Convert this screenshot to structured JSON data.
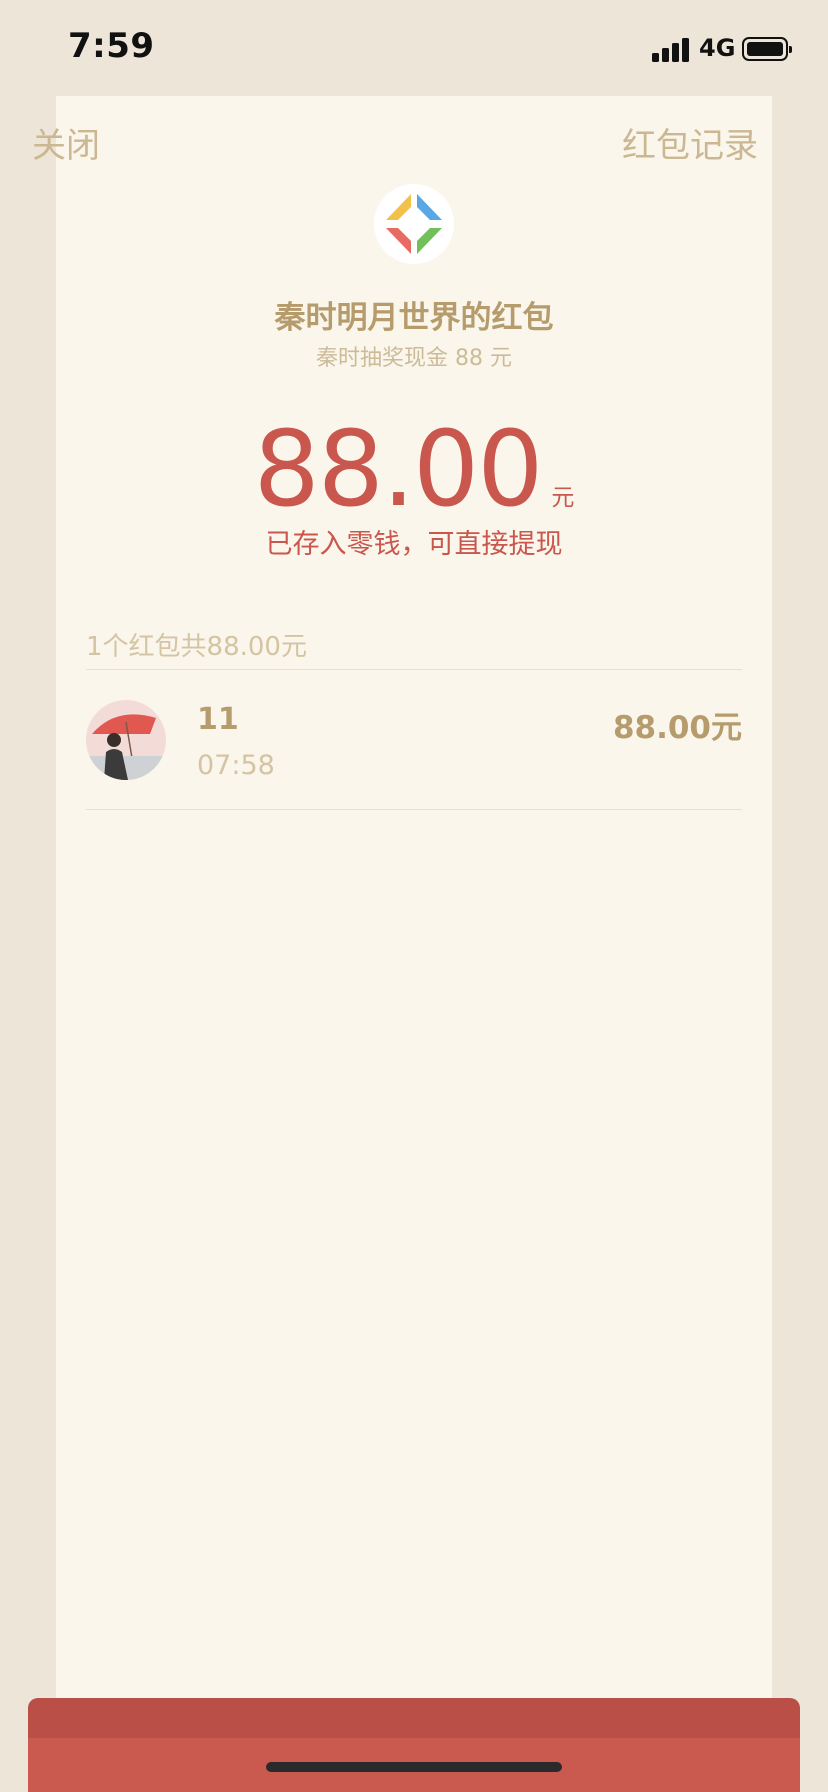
{
  "status_bar": {
    "time": "7:59",
    "network": "4G"
  },
  "nav": {
    "close_label": "关闭",
    "records_label": "红包记录"
  },
  "envelope": {
    "sender_title": "秦时明月世界的红包",
    "subtitle": "秦时抽奖现金 88 元",
    "amount": "88.00",
    "amount_unit": "元",
    "saved_note": "已存入零钱，可直接提现"
  },
  "summary": {
    "text": "1个红包共88.00元"
  },
  "records": [
    {
      "name": "11",
      "time": "07:58",
      "amount": "88.00元"
    }
  ],
  "colors": {
    "accent_red": "#c9574d",
    "gold_text": "#b69c6c",
    "muted_text": "#d4c4a3",
    "card_bg": "#faf6ec",
    "page_bg": "#ede6d8"
  },
  "icons": {
    "logo": "colorful-pinwheel-logo",
    "avatar": "user-avatar-red-umbrella"
  }
}
